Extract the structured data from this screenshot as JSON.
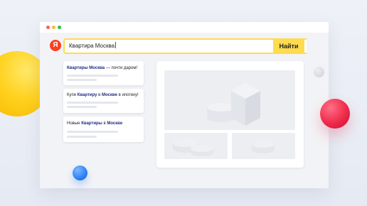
{
  "window": {
    "controls": [
      "close",
      "minimize",
      "maximize"
    ]
  },
  "search": {
    "logo": "Я",
    "query": "Квартира Москва",
    "clear_icon": "×",
    "button_label": "Найти"
  },
  "results": [
    {
      "parts": [
        {
          "text": "Квартиры Москва",
          "bold": true
        },
        {
          "text": " — почти даром!",
          "bold": false
        }
      ]
    },
    {
      "parts": [
        {
          "text": "Купи ",
          "bold": false
        },
        {
          "text": "Квартиру",
          "bold": true
        },
        {
          "text": " в ",
          "bold": false
        },
        {
          "text": "Москве",
          "bold": true
        },
        {
          "text": " в ипотеку!",
          "bold": false
        }
      ]
    },
    {
      "parts": [
        {
          "text": "Новые ",
          "bold": false
        },
        {
          "text": "Квартиры",
          "bold": true
        },
        {
          "text": " в ",
          "bold": false
        },
        {
          "text": "Москве",
          "bold": true
        }
      ]
    }
  ],
  "colors": {
    "accent_yellow": "#ffdb4d",
    "logo_red": "#fc3f1d",
    "highlight_blue": "#1f2c86"
  }
}
